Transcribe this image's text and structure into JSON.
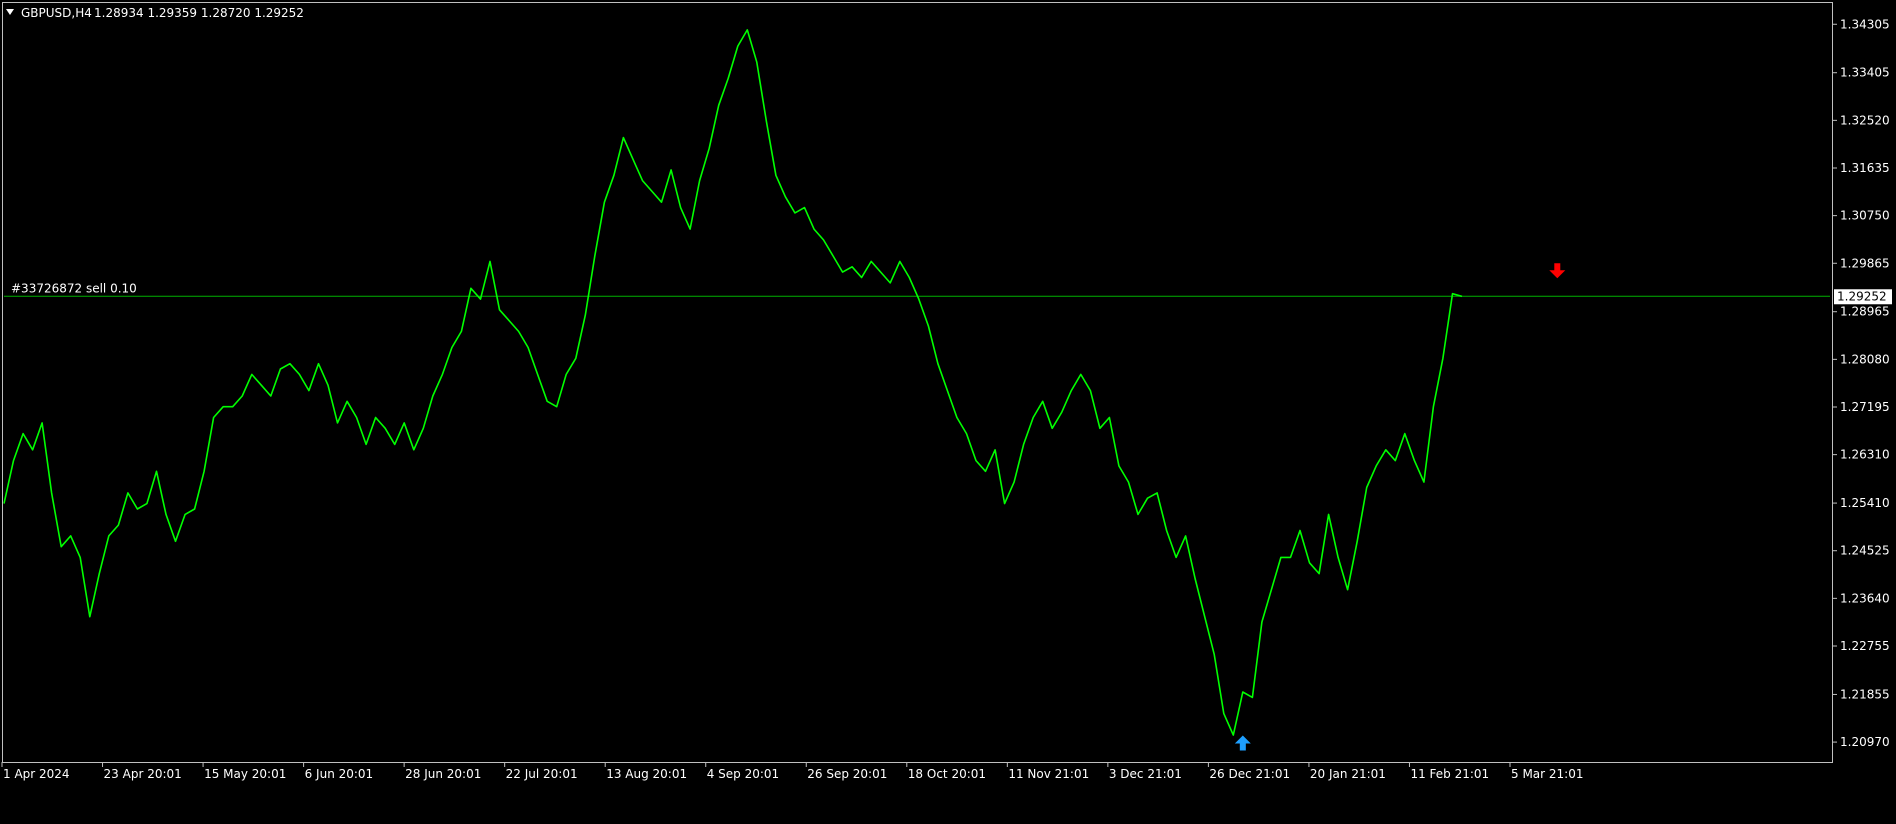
{
  "header": {
    "symbol": "GBPUSD,H4",
    "ohlc": "1.28934 1.29359 1.28720 1.29252"
  },
  "order_line": {
    "label": "#33726872 sell 0.10"
  },
  "current_price_label": "1.29252",
  "colors": {
    "background": "#000000",
    "frame": "#c0c0c0",
    "series": "#00ff00",
    "order_line": "#00b000",
    "sell_arrow": "#ff0000",
    "buy_arrow": "#1e9fff",
    "price_label_bg": "#ffffff",
    "price_label_text": "#000000"
  },
  "chart_data": {
    "type": "line",
    "title": "GBPUSD,H4",
    "xlabel": "",
    "ylabel": "",
    "ylim": [
      1.206,
      1.347
    ],
    "x_ticks": [
      "1 Apr 2024",
      "23 Apr 20:01",
      "15 May 20:01",
      "6 Jun 20:01",
      "28 Jun 20:01",
      "22 Jul 20:01",
      "13 Aug 20:01",
      "4 Sep 20:01",
      "26 Sep 20:01",
      "18 Oct 20:01",
      "11 Nov 21:01",
      "3 Dec 21:01",
      "26 Dec 21:01",
      "20 Jan 21:01",
      "11 Feb 21:01",
      "5 Mar 21:01"
    ],
    "y_ticks": [
      "1.34305",
      "1.33405",
      "1.32520",
      "1.31635",
      "1.30750",
      "1.29865",
      "1.28965",
      "1.28080",
      "1.27195",
      "1.26310",
      "1.25410",
      "1.24525",
      "1.23640",
      "1.22755",
      "1.21855",
      "1.20970"
    ],
    "series": [
      {
        "values": [
          1.254,
          1.262,
          1.267,
          1.264,
          1.269,
          1.256,
          1.246,
          1.248,
          1.244,
          1.233,
          1.241,
          1.248,
          1.25,
          1.256,
          1.253,
          1.254,
          1.26,
          1.252,
          1.247,
          1.252,
          1.253,
          1.26,
          1.27,
          1.272,
          1.272,
          1.274,
          1.278,
          1.276,
          1.274,
          1.279,
          1.28,
          1.278,
          1.275,
          1.28,
          1.276,
          1.269,
          1.273,
          1.27,
          1.265,
          1.27,
          1.268,
          1.265,
          1.269,
          1.264,
          1.268,
          1.274,
          1.278,
          1.283,
          1.286,
          1.294,
          1.292,
          1.299,
          1.29,
          1.288,
          1.286,
          1.283,
          1.278,
          1.273,
          1.272,
          1.278,
          1.281,
          1.289,
          1.3,
          1.31,
          1.315,
          1.322,
          1.318,
          1.314,
          1.312,
          1.31,
          1.316,
          1.309,
          1.305,
          1.314,
          1.32,
          1.328,
          1.333,
          1.339,
          1.342,
          1.336,
          1.325,
          1.315,
          1.311,
          1.308,
          1.309,
          1.305,
          1.303,
          1.3,
          1.297,
          1.298,
          1.296,
          1.299,
          1.297,
          1.295,
          1.299,
          1.296,
          1.292,
          1.287,
          1.28,
          1.275,
          1.27,
          1.267,
          1.262,
          1.26,
          1.264,
          1.254,
          1.258,
          1.265,
          1.27,
          1.273,
          1.268,
          1.271,
          1.275,
          1.278,
          1.275,
          1.268,
          1.27,
          1.261,
          1.258,
          1.252,
          1.255,
          1.256,
          1.249,
          1.244,
          1.248,
          1.24,
          1.233,
          1.226,
          1.215,
          1.211,
          1.219,
          1.218,
          1.232,
          1.238,
          1.244,
          1.244,
          1.249,
          1.243,
          1.241,
          1.252,
          1.244,
          1.238,
          1.247,
          1.257,
          1.261,
          1.264,
          1.262,
          1.267,
          1.262,
          1.258,
          1.272,
          1.281,
          1.293,
          1.2925
        ]
      }
    ],
    "order_line_price": 1.29252,
    "sell_arrow": {
      "index": 163,
      "price": 1.2968
    },
    "buy_arrow": {
      "index": 130,
      "price": 1.21
    }
  }
}
